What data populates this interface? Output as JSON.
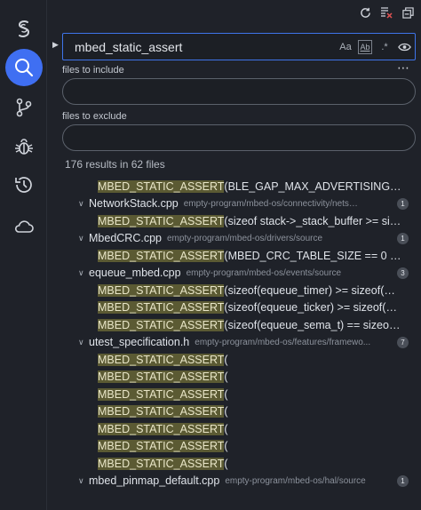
{
  "activity_bar": {
    "items": [
      {
        "name": "logo",
        "icon": "app-logo-icon"
      },
      {
        "name": "search",
        "icon": "search-icon",
        "active": true
      },
      {
        "name": "source-control",
        "icon": "source-control-icon"
      },
      {
        "name": "debug",
        "icon": "bug-icon"
      },
      {
        "name": "history",
        "icon": "history-icon"
      },
      {
        "name": "cloud",
        "icon": "cloud-icon"
      }
    ],
    "accent": "#3f6ff2"
  },
  "title_actions": [
    "refresh-icon",
    "clear-results-icon",
    "collapse-all-icon"
  ],
  "search": {
    "value": "mbed_static_assert",
    "options": {
      "match_case": "Aa",
      "whole_word": "Ab",
      "regex": ".*"
    },
    "toggle_details": "⋯"
  },
  "include": {
    "label": "files to include",
    "value": ""
  },
  "exclude": {
    "label": "files to exclude",
    "value": ""
  },
  "summary": "176 results in 62 files",
  "results": [
    {
      "type": "match",
      "hl": "MBED_STATIC_ASSERT",
      "rest": "(BLE_GAP_MAX_ADVERTISING_S..."
    },
    {
      "type": "file",
      "name": "NetworkStack.cpp",
      "path": "empty-program/mbed-os/connectivity/netsock...",
      "count": "1"
    },
    {
      "type": "match",
      "hl": "MBED_STATIC_ASSERT",
      "rest": "(sizeof stack->_stack_buffer >= size..."
    },
    {
      "type": "file",
      "name": "MbedCRC.cpp",
      "path": "empty-program/mbed-os/drivers/source",
      "count": "1"
    },
    {
      "type": "match",
      "hl": "MBED_STATIC_ASSERT",
      "rest": "(MBED_CRC_TABLE_SIZE == 0 || ..."
    },
    {
      "type": "file",
      "name": "equeue_mbed.cpp",
      "path": "empty-program/mbed-os/events/source",
      "count": "3"
    },
    {
      "type": "match",
      "hl": "MBED_STATIC_ASSERT",
      "rest": "(sizeof(equeue_timer) >= sizeof(ALI..."
    },
    {
      "type": "match",
      "hl": "MBED_STATIC_ASSERT",
      "rest": "(sizeof(equeue_ticker) >= sizeof(ALI..."
    },
    {
      "type": "match",
      "hl": "MBED_STATIC_ASSERT",
      "rest": "(sizeof(equeue_sema_t) == sizeof(rt..."
    },
    {
      "type": "file",
      "name": "utest_specification.h",
      "path": "empty-program/mbed-os/features/framewo...",
      "count": "7"
    },
    {
      "type": "match",
      "hl": "MBED_STATIC_ASSERT",
      "rest": "("
    },
    {
      "type": "match",
      "hl": "MBED_STATIC_ASSERT",
      "rest": "("
    },
    {
      "type": "match",
      "hl": "MBED_STATIC_ASSERT",
      "rest": "("
    },
    {
      "type": "match",
      "hl": "MBED_STATIC_ASSERT",
      "rest": "("
    },
    {
      "type": "match",
      "hl": "MBED_STATIC_ASSERT",
      "rest": "("
    },
    {
      "type": "match",
      "hl": "MBED_STATIC_ASSERT",
      "rest": "("
    },
    {
      "type": "match",
      "hl": "MBED_STATIC_ASSERT",
      "rest": "("
    },
    {
      "type": "file",
      "name": "mbed_pinmap_default.cpp",
      "path": "empty-program/mbed-os/hal/source",
      "count": "1"
    }
  ]
}
